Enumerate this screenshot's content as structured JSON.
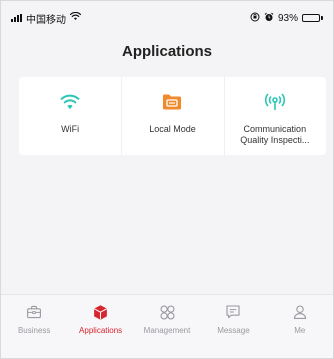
{
  "status_bar": {
    "carrier": "中国移动",
    "battery_percent": "93%",
    "battery_level": 0.93
  },
  "header": {
    "title": "Applications"
  },
  "apps": [
    {
      "label": "WiFi",
      "icon": "wifi-icon",
      "color": "#2bc6b6"
    },
    {
      "label": "Local Mode",
      "icon": "folder-icon",
      "color": "#f08a2c"
    },
    {
      "label": "Communication Quality Inspecti...",
      "icon": "signal-antenna-icon",
      "color": "#2bc6b6"
    }
  ],
  "bottom_nav": {
    "items": [
      {
        "label": "Business",
        "icon": "briefcase-icon",
        "active": false
      },
      {
        "label": "Applications",
        "icon": "cube-icon",
        "active": true
      },
      {
        "label": "Management",
        "icon": "clover-icon",
        "active": false
      },
      {
        "label": "Message",
        "icon": "message-icon",
        "active": false
      },
      {
        "label": "Me",
        "icon": "person-icon",
        "active": false
      }
    ]
  },
  "colors": {
    "accent": "#d7262e",
    "teal": "#2bc6b6",
    "orange": "#f08a2c",
    "inactive": "#9a9aa0"
  }
}
